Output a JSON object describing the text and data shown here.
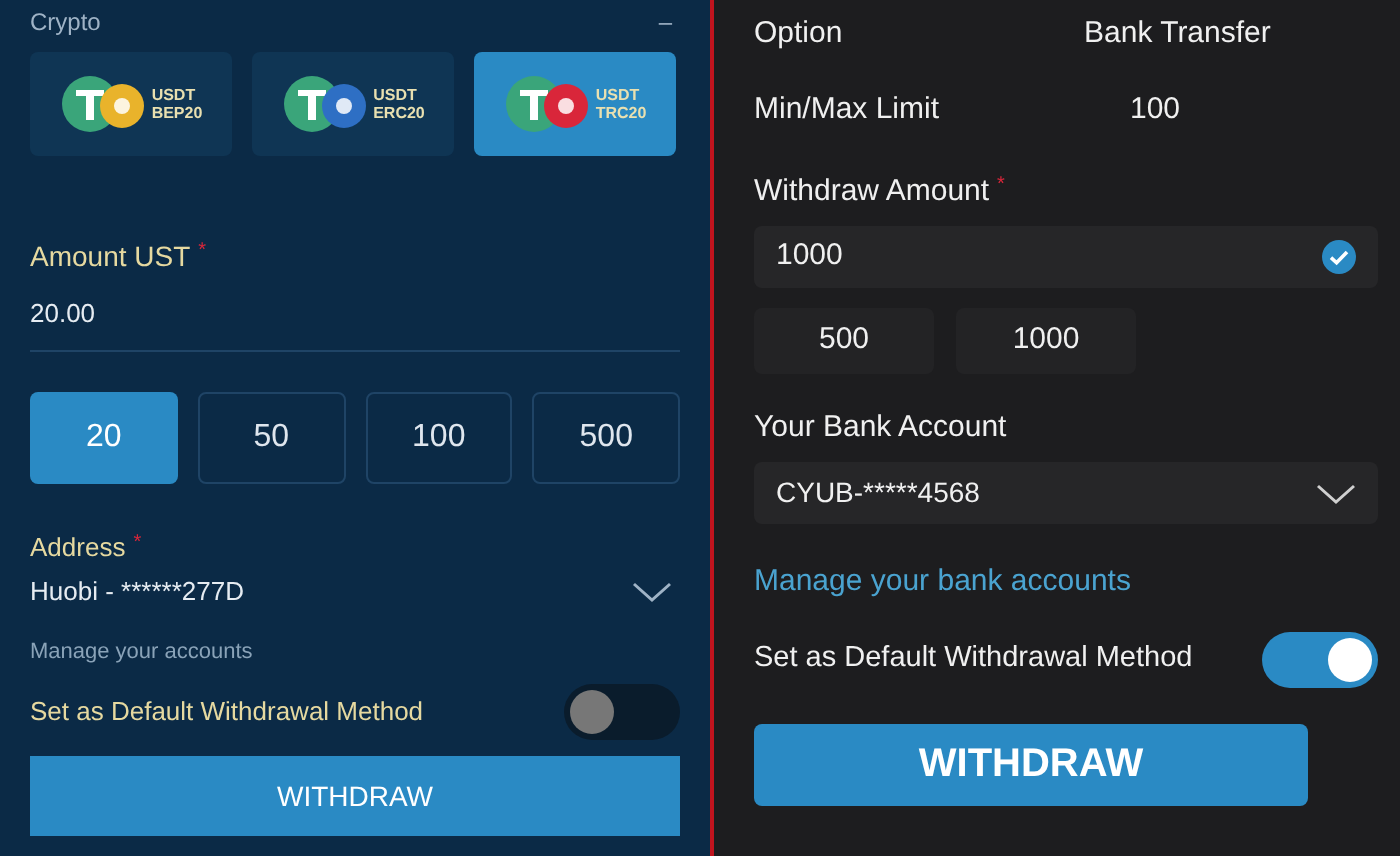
{
  "crypto_panel": {
    "section_title": "Crypto",
    "collapse_symbol": "–",
    "coins": [
      {
        "name": "USDT",
        "network": "BEP20",
        "color": "#e9b32b",
        "selected": false
      },
      {
        "name": "USDT",
        "network": "ERC20",
        "color": "#2e6fc4",
        "selected": false
      },
      {
        "name": "USDT",
        "network": "TRC20",
        "color": "#d9263a",
        "selected": true
      }
    ],
    "amount": {
      "label": "Amount UST",
      "required_mark": "*",
      "value": "20.00"
    },
    "amount_chips": [
      {
        "label": "20",
        "selected": true
      },
      {
        "label": "50",
        "selected": false
      },
      {
        "label": "100",
        "selected": false
      },
      {
        "label": "500",
        "selected": false
      }
    ],
    "address": {
      "label": "Address",
      "required_mark": "*",
      "value": "Huobi - ******277D"
    },
    "manage_link": "Manage your accounts",
    "default_toggle": {
      "label": "Set as Default Withdrawal Method",
      "on": false
    },
    "submit": "WITHDRAW"
  },
  "bank_panel": {
    "info_rows": [
      {
        "label": "Option",
        "value": "Bank Transfer"
      },
      {
        "label": "Min/Max Limit",
        "value": "100"
      }
    ],
    "amount": {
      "label": "Withdraw Amount",
      "required_mark": "*",
      "value": "1000",
      "valid": true
    },
    "amount_chips": [
      {
        "label": "500",
        "selected": false
      },
      {
        "label": "1000",
        "selected": false
      }
    ],
    "account": {
      "label": "Your Bank Account",
      "value": "CYUB-*****4568"
    },
    "manage_link": "Manage your bank accounts",
    "default_toggle": {
      "label": "Set as Default Withdrawal Method",
      "on": true
    },
    "submit": "WITHDRAW"
  }
}
